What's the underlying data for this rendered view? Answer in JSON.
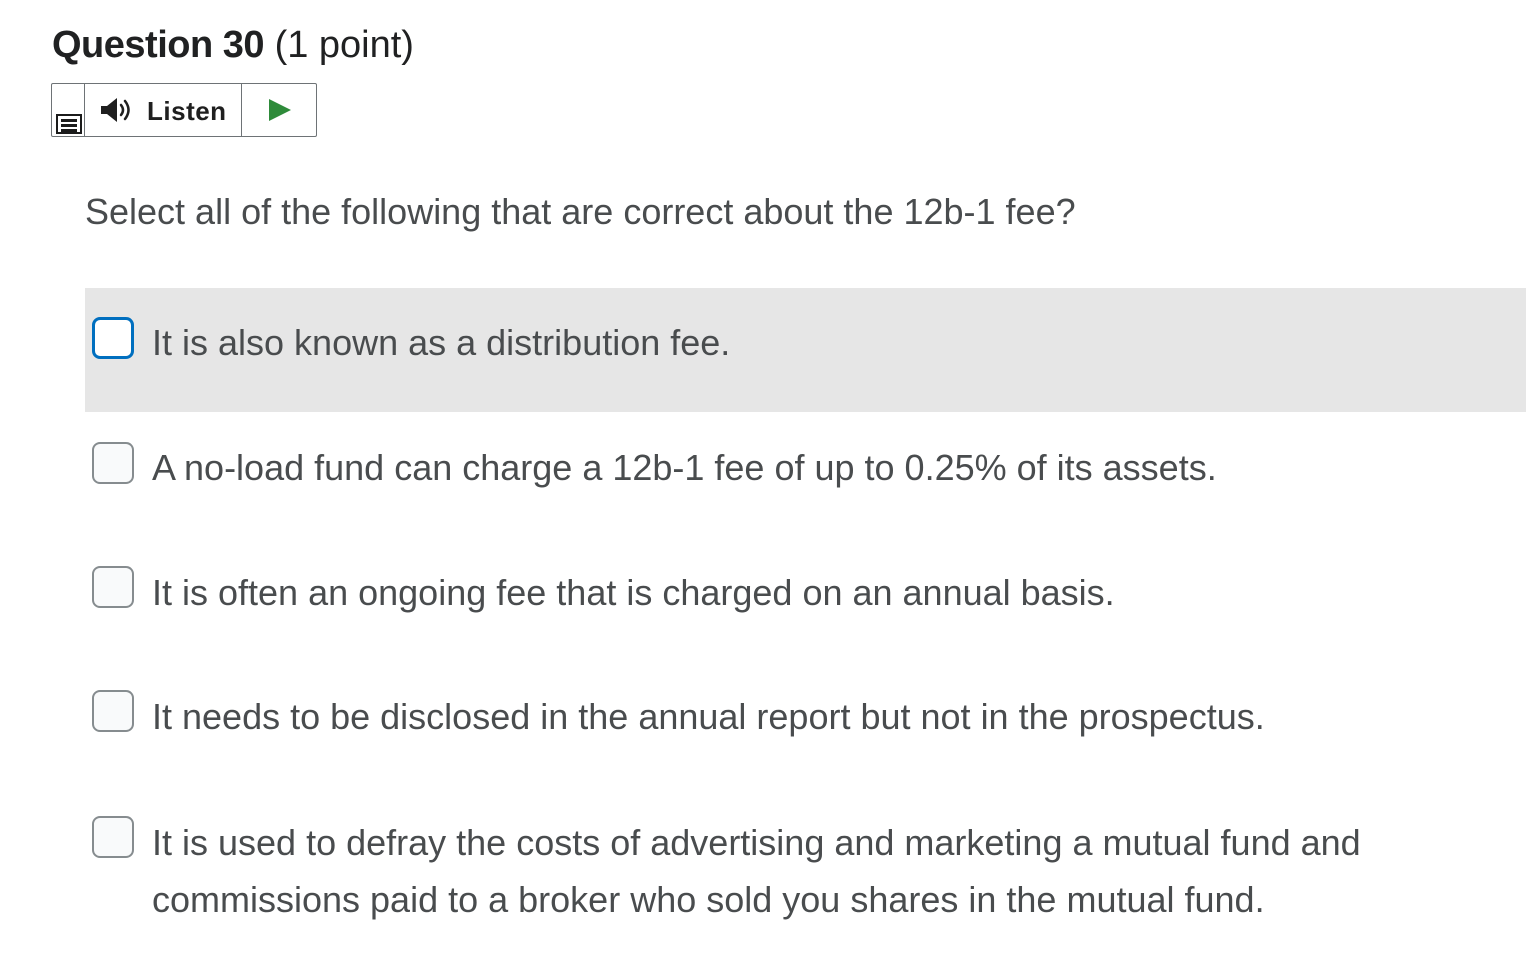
{
  "question": {
    "title": "Question 30",
    "points": "(1 point)"
  },
  "toolbar": {
    "listen_label": "Listen",
    "menu_icon": "menu-icon",
    "speaker_icon": "speaker-icon",
    "play_icon": "play-icon",
    "play_color": "#2e8b3a"
  },
  "prompt": "Select all of the following that are correct about the 12b-1 fee?",
  "options": [
    {
      "label": "It is also known as a distribution fee.",
      "checked": false,
      "state": "hover-focused"
    },
    {
      "label": "A no-load fund can charge a 12b-1 fee of up to 0.25% of its assets.",
      "checked": false
    },
    {
      "label": "It is often an ongoing fee that is charged on an annual basis.",
      "checked": false
    },
    {
      "label": "It needs to be disclosed in the annual report but not in the prospectus.",
      "checked": false
    },
    {
      "label": "It is used to defray the costs of advertising and marketing a mutual fund and commissions paid to a broker who sold you shares in the mutual fund.",
      "checked": false
    }
  ],
  "colors": {
    "focus_ring": "#006fbf",
    "hover_bg": "#e6e6e6",
    "text": "#494c4e"
  }
}
